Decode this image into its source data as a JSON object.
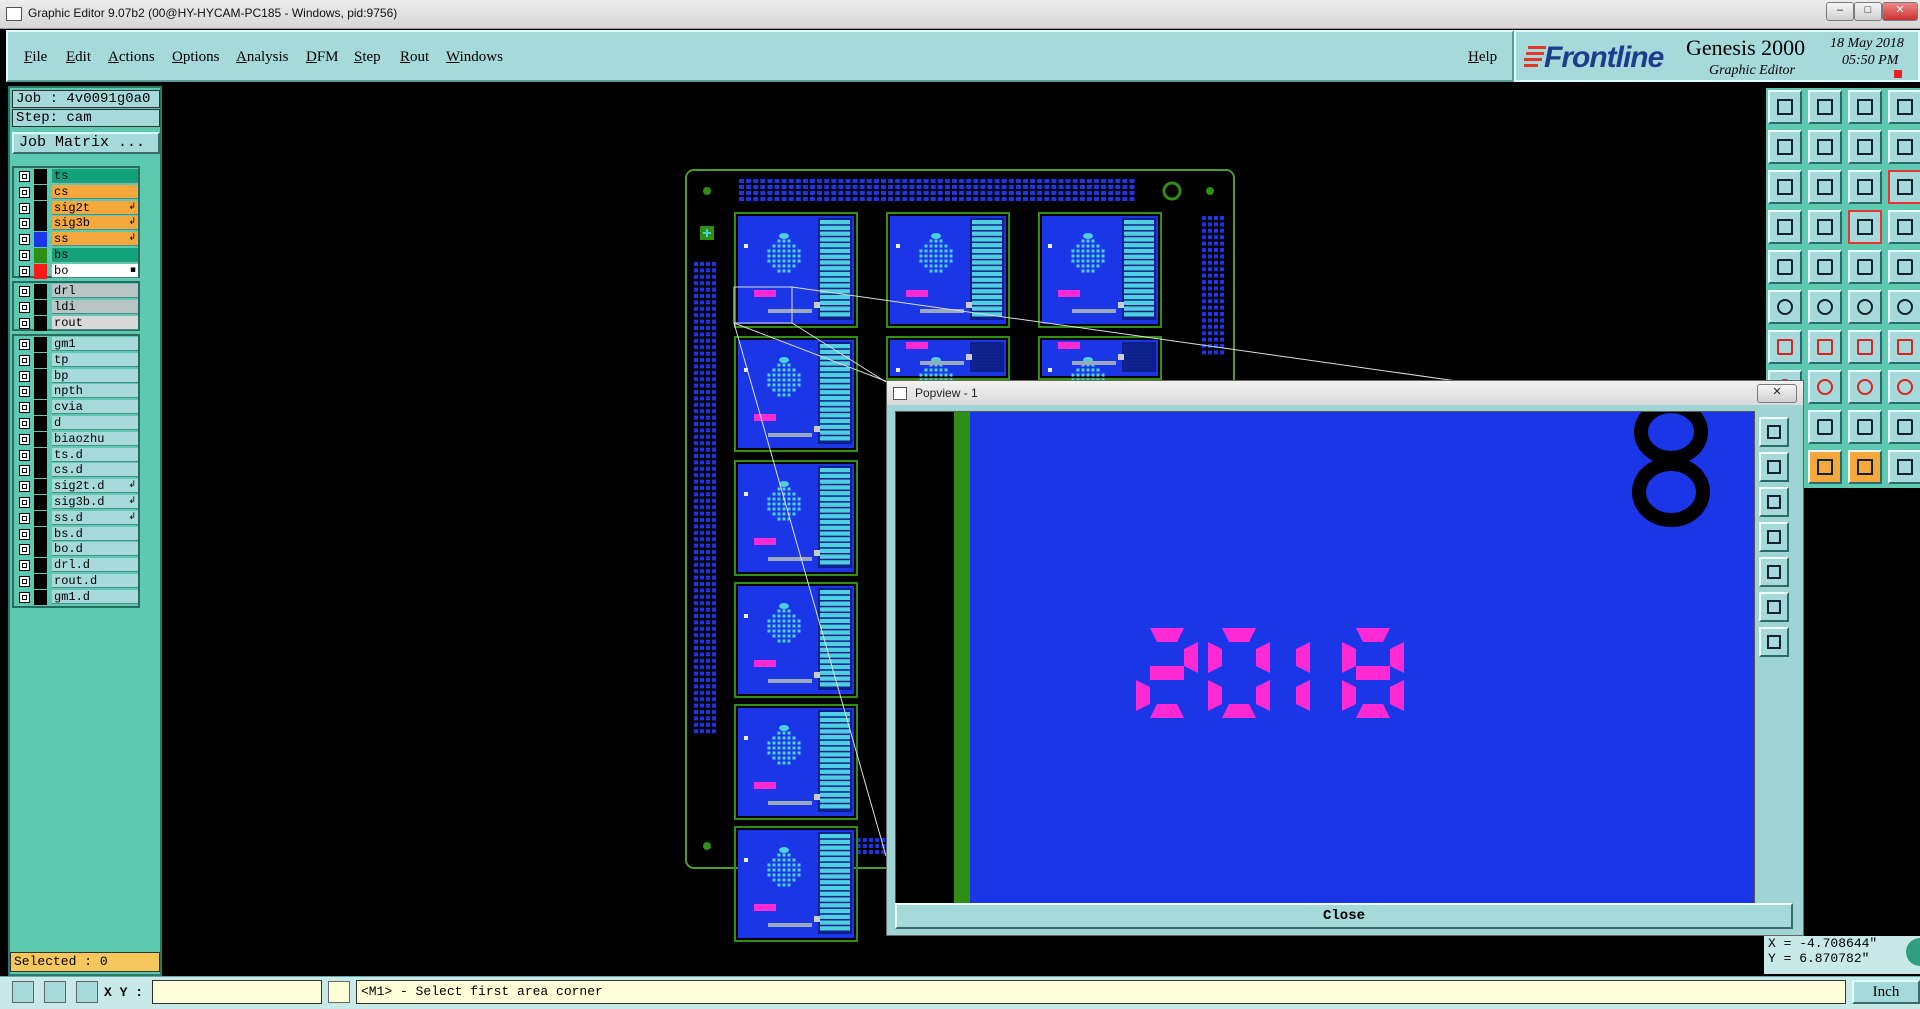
{
  "window": {
    "title": "Graphic Editor 9.07b2 (00@HY-HYCAM-PC185 - Windows, pid:9756)",
    "minimize": "–",
    "restore": "□",
    "close": "✕"
  },
  "menu": {
    "items": [
      "File",
      "Edit",
      "Actions",
      "Options",
      "Analysis",
      "DFM",
      "Step",
      "Rout",
      "Windows"
    ],
    "help": "Help"
  },
  "brand": {
    "logo": "Frontline",
    "product": "Genesis 2000",
    "subtitle": "Graphic Editor",
    "date": "18 May 2018",
    "time": "05:50 PM"
  },
  "job": {
    "job_label": "Job : 4v0091g0a0",
    "step_label": "Step: cam",
    "matrix_button": "Job Matrix ..."
  },
  "layers": {
    "group1": [
      {
        "name": "ts",
        "color": "#12a37a",
        "mark": ""
      },
      {
        "name": "cs",
        "color": "#f6a83c",
        "mark": ""
      },
      {
        "name": "sig2t",
        "color": "#f6a83c",
        "mark": "↲"
      },
      {
        "name": "sig3b",
        "color": "#f6a83c",
        "mark": "↲"
      },
      {
        "name": "ss",
        "color": "#f6a83c",
        "mark": "↲"
      },
      {
        "name": "bs",
        "color": "#12a37a",
        "mark": ""
      },
      {
        "name": "bo",
        "color": "#ffffff",
        "mark": "▪"
      }
    ],
    "group2": [
      {
        "name": "drl",
        "color": "#b9c4c4",
        "mark": ""
      },
      {
        "name": "ldi",
        "color": "#b9c4c4",
        "mark": ""
      },
      {
        "name": "rout",
        "color": "#d9d9d9",
        "mark": ""
      }
    ],
    "group3": [
      {
        "name": "gm1",
        "mark": ""
      },
      {
        "name": "tp",
        "mark": ""
      },
      {
        "name": "bp",
        "mark": ""
      },
      {
        "name": "npth",
        "mark": ""
      },
      {
        "name": "cvia",
        "mark": ""
      },
      {
        "name": "d",
        "mark": ""
      },
      {
        "name": "biaozhu",
        "mark": ""
      },
      {
        "name": "ts.d",
        "mark": ""
      },
      {
        "name": "cs.d",
        "mark": ""
      },
      {
        "name": "sig2t.d",
        "mark": "↲"
      },
      {
        "name": "sig3b.d",
        "mark": "↲"
      },
      {
        "name": "ss.d",
        "mark": "↲"
      },
      {
        "name": "bs.d",
        "mark": ""
      },
      {
        "name": "bo.d",
        "mark": ""
      },
      {
        "name": "drl.d",
        "mark": ""
      },
      {
        "name": "rout.d",
        "mark": ""
      },
      {
        "name": "gm1.d",
        "mark": ""
      }
    ]
  },
  "status": {
    "selected": "Selected : 0",
    "xy_label": "X Y :",
    "xy_value": "",
    "prompt": "<M1> - Select first area corner",
    "units": "Inch",
    "coord_x": "X = -4.708644\"",
    "coord_y": "Y = 6.870782\""
  },
  "popview": {
    "title": "Popview - 1",
    "close_label": "Close",
    "zoom_text": "2018",
    "corner_text": "8"
  },
  "colors": {
    "panel": "#5cc9b0",
    "menubar": "#a6d9d9",
    "board_blue": "#1a36e6",
    "silkscreen": "#ff2ad4",
    "copper_green": "#2f8f12",
    "pad_cyan": "#4fd0e0"
  }
}
